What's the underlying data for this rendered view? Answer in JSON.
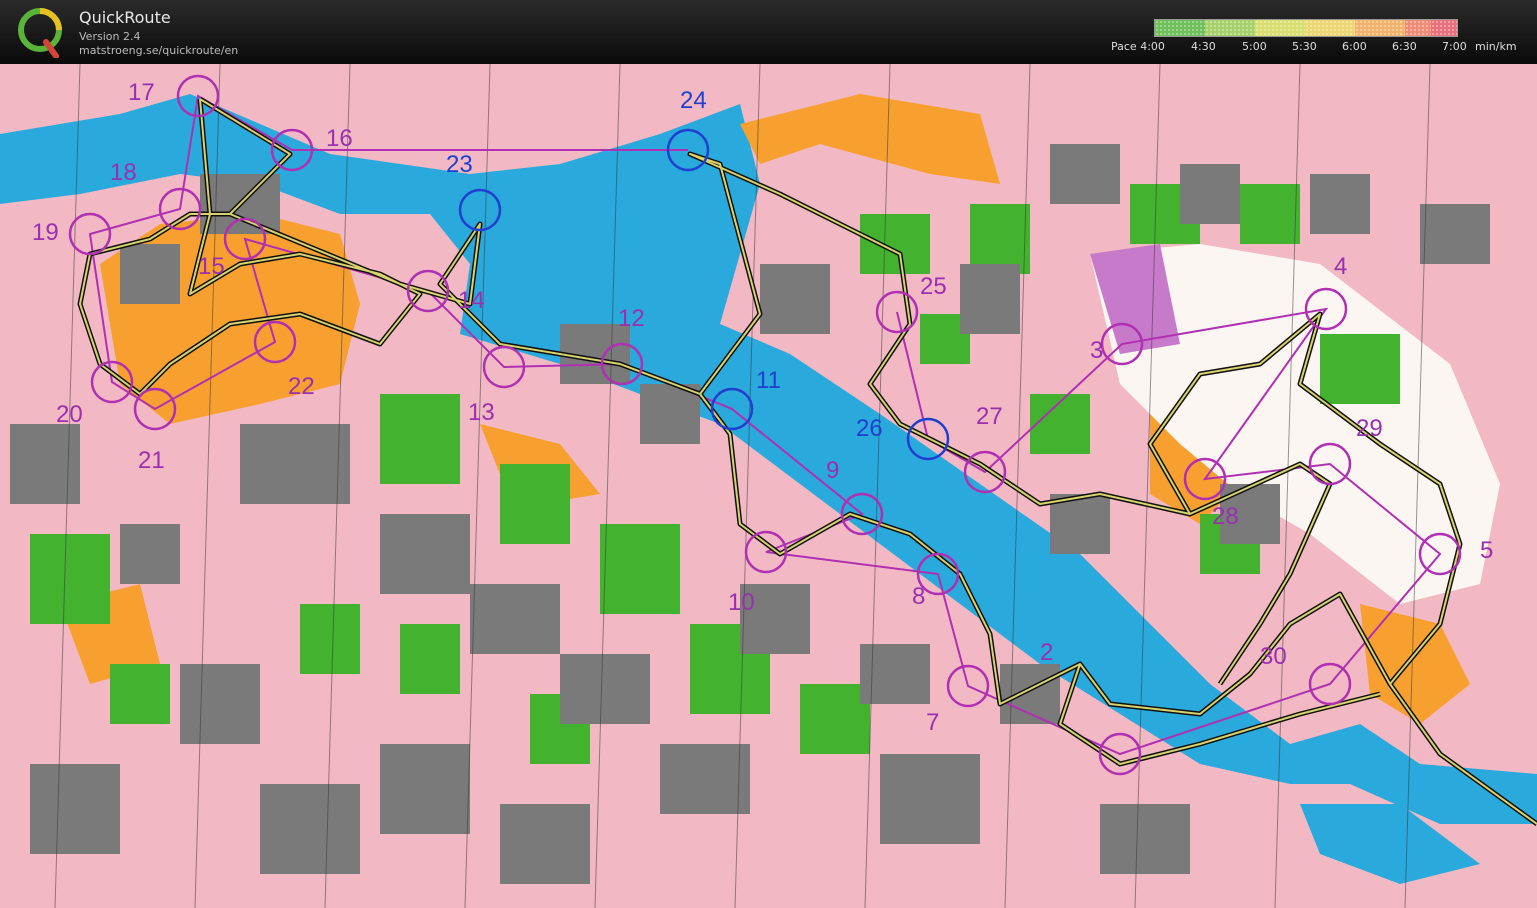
{
  "app": {
    "title": "QuickRoute",
    "version": "Version 2.4",
    "url": "matstroeng.se/quickroute/en",
    "logo_letter": "Q"
  },
  "legend": {
    "labels": [
      "Pace 4:00",
      "4:30",
      "5:00",
      "5:30",
      "6:00",
      "6:30",
      "7:00",
      "min/km"
    ],
    "colors": [
      "#6fbf5a",
      "#a6d16a",
      "#d8df70",
      "#ecd772",
      "#f0b36e",
      "#ee8c76",
      "#e8707a"
    ]
  },
  "colors": {
    "water": "#2aa9dc",
    "street": "#f2b9c4",
    "building": "#7a7a7a",
    "park": "#43b22f",
    "open_land": "#f7a030",
    "course": "#b02fb2",
    "route_outer": "#111111",
    "route_inner": "#d7d36e"
  },
  "controls": [
    {
      "label": "17"
    },
    {
      "label": "16"
    },
    {
      "label": "18"
    },
    {
      "label": "19"
    },
    {
      "label": "15"
    },
    {
      "label": "20"
    },
    {
      "label": "21"
    },
    {
      "label": "22"
    },
    {
      "label": "23"
    },
    {
      "label": "24"
    },
    {
      "label": "14"
    },
    {
      "label": "13"
    },
    {
      "label": "12"
    },
    {
      "label": "11"
    },
    {
      "label": "25"
    },
    {
      "label": "26"
    },
    {
      "label": "27"
    },
    {
      "label": "9"
    },
    {
      "label": "10"
    },
    {
      "label": "8"
    },
    {
      "label": "7"
    },
    {
      "label": "3"
    },
    {
      "label": "4"
    },
    {
      "label": "28"
    },
    {
      "label": "29"
    },
    {
      "label": "5"
    },
    {
      "label": "30"
    },
    {
      "label": "2"
    }
  ]
}
